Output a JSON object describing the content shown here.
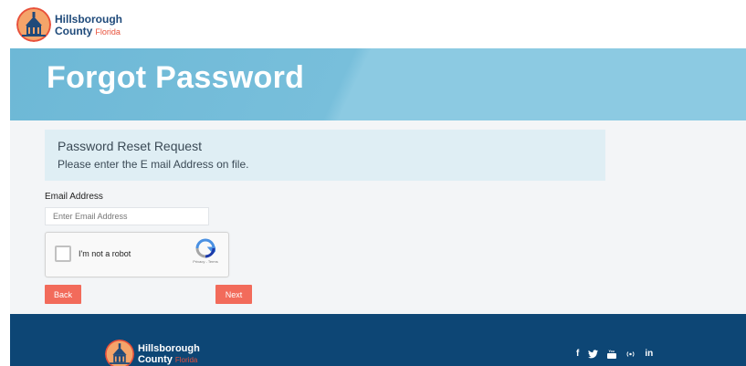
{
  "header": {
    "logo": {
      "line1": "Hillsborough",
      "line2": "County",
      "line2_accent": "Florida"
    }
  },
  "hero": {
    "title": "Forgot Password"
  },
  "notice": {
    "title": "Password Reset Request",
    "description": "Please enter the E mail Address on file."
  },
  "form": {
    "email_label": "Email Address",
    "email_placeholder": "Enter Email Address",
    "email_value": "",
    "captcha_label": "I'm not a robot",
    "captcha_brand_text": "Privacy - Terms",
    "back_label": "Back",
    "next_label": "Next"
  },
  "footer": {
    "logo": {
      "line1": "Hillsborough",
      "line2": "County",
      "line2_accent": "Florida"
    },
    "social": [
      {
        "icon": "facebook-icon",
        "glyph": "f"
      },
      {
        "icon": "twitter-icon",
        "glyph": "🐦"
      },
      {
        "icon": "youtube-icon",
        "glyph": "▶"
      },
      {
        "icon": "podcast-icon",
        "glyph": "((·))"
      },
      {
        "icon": "linkedin-icon",
        "glyph": "in"
      }
    ]
  },
  "colors": {
    "hero_bg": "#78bfdb",
    "footer_bg": "#0d4675",
    "button": "#f26b5b",
    "notice_bg": "#dfeef4",
    "brand_navy": "#1f4a7a",
    "brand_orange": "#e8503a"
  }
}
